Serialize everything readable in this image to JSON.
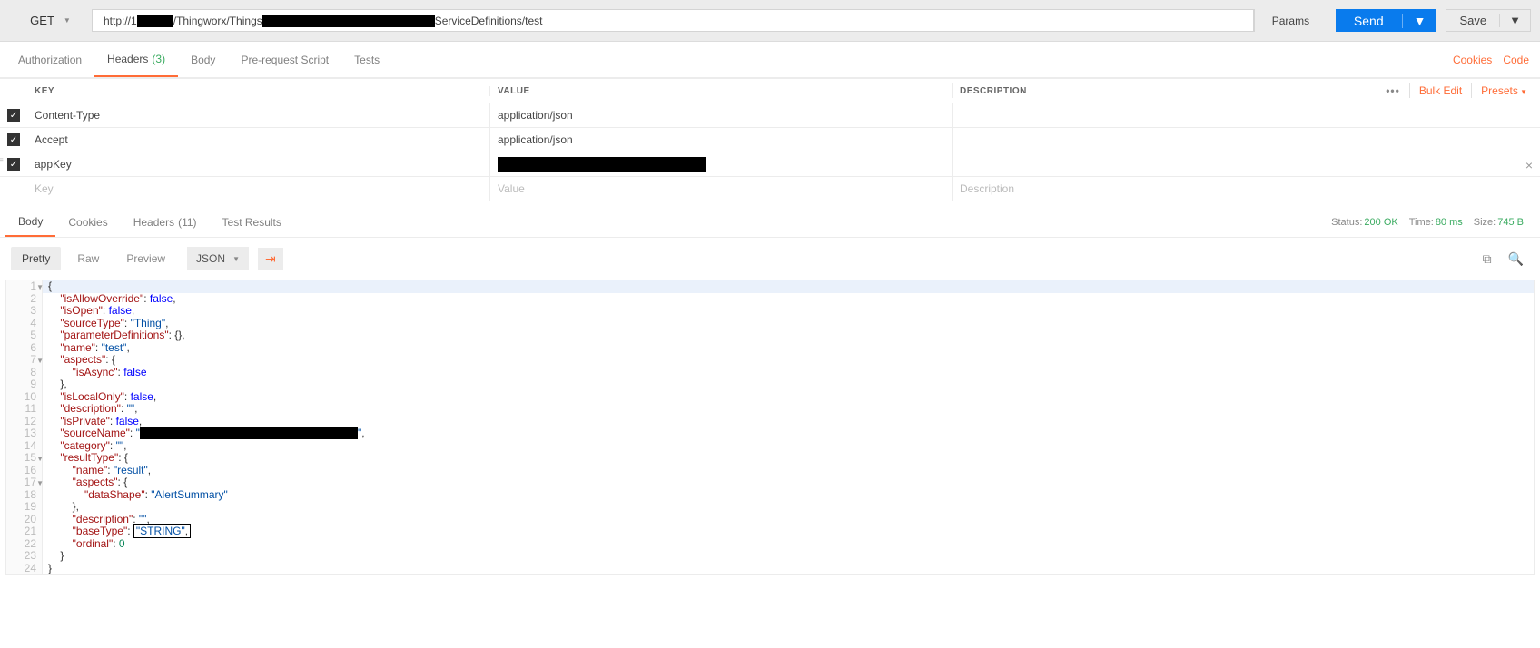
{
  "request": {
    "method": "GET",
    "url_prefix": "http://1",
    "url_mid": "/Thingworx/Things",
    "url_suffix": "ServiceDefinitions/test",
    "params_btn": "Params",
    "send_btn": "Send",
    "save_btn": "Save"
  },
  "req_tabs": {
    "authorization": "Authorization",
    "headers": "Headers",
    "headers_count": "(3)",
    "body": "Body",
    "prerequest": "Pre-request Script",
    "tests": "Tests",
    "cookies_link": "Cookies",
    "code_link": "Code"
  },
  "hdr_table": {
    "th_key": "KEY",
    "th_value": "VALUE",
    "th_desc": "DESCRIPTION",
    "bulk": "Bulk Edit",
    "presets": "Presets",
    "rows": [
      {
        "key": "Content-Type",
        "value": "application/json",
        "desc": ""
      },
      {
        "key": "Accept",
        "value": "application/json",
        "desc": ""
      },
      {
        "key": "appKey",
        "value": "",
        "desc": ""
      }
    ],
    "ph_key": "Key",
    "ph_value": "Value",
    "ph_desc": "Description"
  },
  "resp_tabs": {
    "body": "Body",
    "cookies": "Cookies",
    "headers": "Headers",
    "headers_count": "(11)",
    "test_results": "Test Results",
    "status_lbl": "Status:",
    "status_val": "200 OK",
    "time_lbl": "Time:",
    "time_val": "80 ms",
    "size_lbl": "Size:",
    "size_val": "745 B"
  },
  "resp_toolbar": {
    "pretty": "Pretty",
    "raw": "Raw",
    "preview": "Preview",
    "format": "JSON"
  },
  "json_body": {
    "isAllowOverride": false,
    "isOpen": false,
    "sourceType": "Thing",
    "parameterDefinitions": {},
    "name": "test",
    "aspects": {
      "isAsync": false
    },
    "isLocalOnly": false,
    "description": "",
    "isPrivate": false,
    "sourceName": "[redacted]",
    "category": "",
    "resultType": {
      "name": "result",
      "aspects": {
        "dataShape": "AlertSummary"
      },
      "description": "",
      "baseType": "STRING",
      "ordinal": 0
    }
  }
}
